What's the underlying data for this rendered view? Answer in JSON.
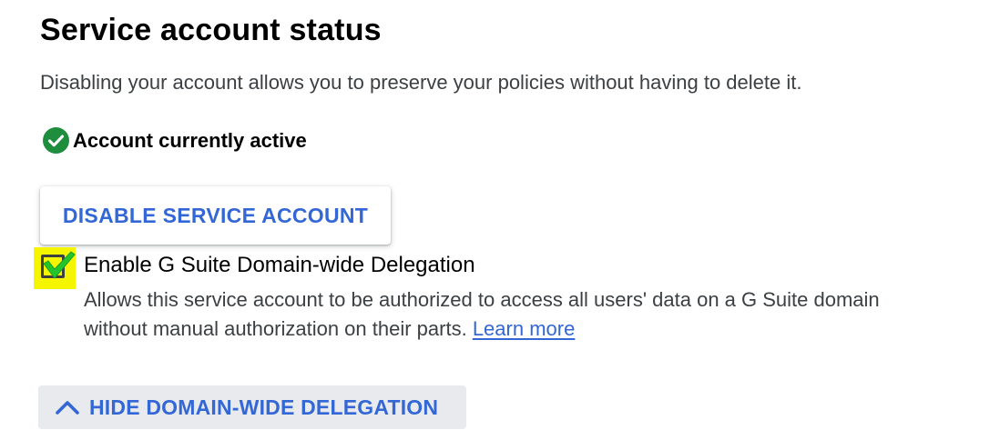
{
  "section": {
    "title": "Service account status",
    "description": "Disabling your account allows you to preserve your policies without having to delete it."
  },
  "status": {
    "icon": "check-circle-icon",
    "text": "Account currently active",
    "color": "#1e8e3e"
  },
  "actions": {
    "disable_label": "DISABLE SERVICE ACCOUNT",
    "hide_delegation_label": "HIDE DOMAIN-WIDE DELEGATION"
  },
  "delegation": {
    "checked": true,
    "label": "Enable G Suite Domain-wide Delegation",
    "help_line_1": "Allows this service account to be authorized to access all users' data on a G Suite domain",
    "help_line_2": "without manual authorization on their parts.",
    "learn_more": "Learn more"
  },
  "colors": {
    "accent": "#3367d6",
    "highlight": "#f5f500",
    "check_green": "#22c52c"
  }
}
